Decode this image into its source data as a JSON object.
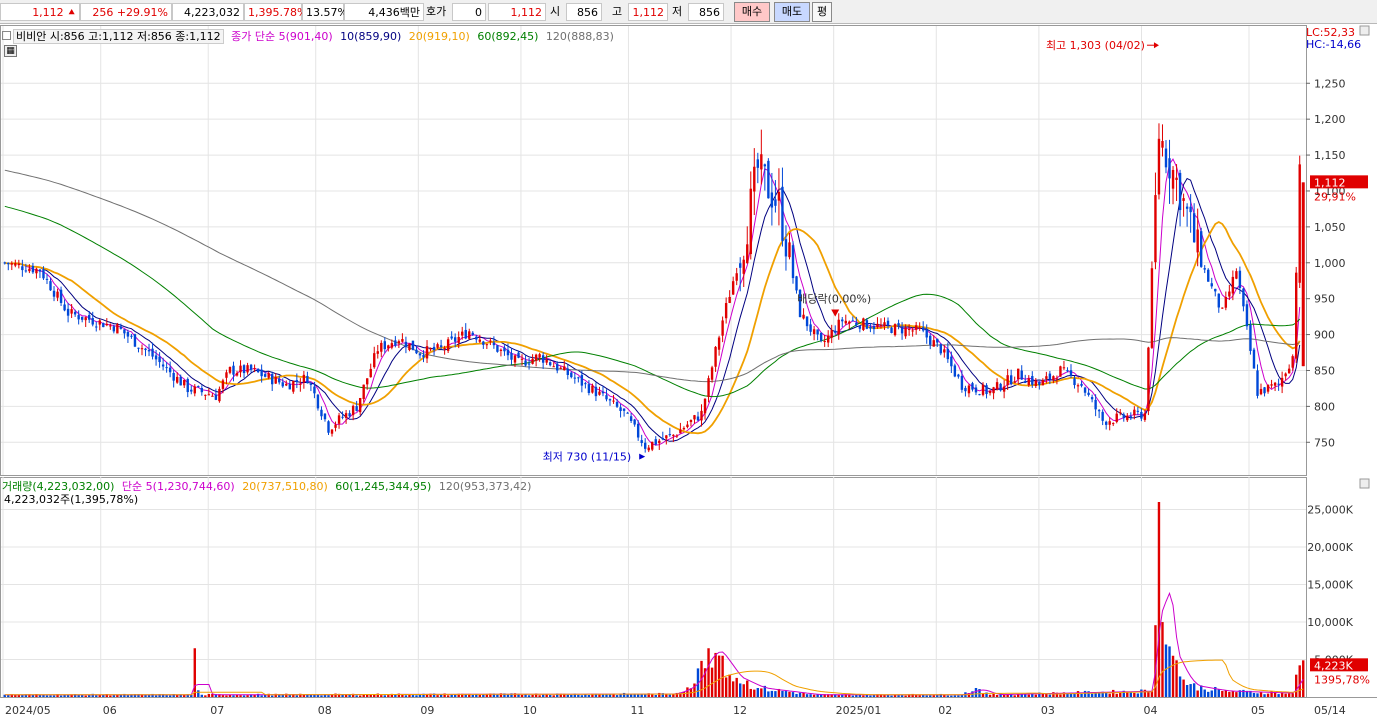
{
  "top_bar": {
    "price": "1,112",
    "change": "256",
    "change_pct": "+29.91%",
    "volume": "4,223,032",
    "volume_pct": "1,395.78%",
    "turnover": "13.57%",
    "amount": "4,436백만",
    "quote_label": "호가",
    "quote_value": "0",
    "quote_price": "1,112",
    "open_label": "시",
    "open_value": "856",
    "high_label": "고",
    "high_value": "1,112",
    "low_label": "저",
    "low_value": "856",
    "buy_label": "매수",
    "sell_label": "매도",
    "flat_label": "평",
    "colors": {
      "up": "#e00000",
      "down": "#0000cc"
    }
  },
  "price_panel": {
    "legend": {
      "stock": "비비안 시:856 고:1,112 저:856 종:1,112",
      "ma_label": "종가 단순 5(901,40)",
      "ma10": "10(859,90)",
      "ma20": "20(919,10)",
      "ma60": "60(892,45)",
      "ma120": "120(888,83)"
    },
    "right_info": {
      "lc": "LC:52,33",
      "hc": "HC:-14,66"
    },
    "current_price_tag": "1,112",
    "current_change_tag": "29,91%",
    "high_marker": "최고 1,303 (04/02)",
    "low_marker": "최저 730 (11/15)",
    "ex_dividend_marker": "배당락(0,00%)"
  },
  "volume_panel": {
    "legend": {
      "volume": "거래량(4,223,032,00)",
      "ma5": "단순 5(1,230,744,60)",
      "ma20": "20(737,510,80)",
      "ma60": "60(1,245,344,95)",
      "ma120": "120(953,373,42)"
    },
    "sub_label": "4,223,032주(1,395,78%)",
    "current_volume_tag": "4,223K",
    "current_volume_pct": "1395,78%"
  },
  "chart_data": {
    "type": "candlestick",
    "price_axis": {
      "ticks": [
        750,
        800,
        850,
        900,
        950,
        1000,
        1050,
        1100,
        1150,
        1200,
        1250
      ],
      "tick_labels": [
        "750",
        "800",
        "850",
        "900",
        "950",
        "1,000",
        "1,050",
        "1,100",
        "1,150",
        "1,200",
        "1,250"
      ],
      "range": [
        710,
        1320
      ]
    },
    "volume_axis": {
      "ticks": [
        5000,
        10000,
        15000,
        20000,
        25000
      ],
      "tick_labels": [
        "5,000K",
        "10,000K",
        "15,000K",
        "20,000K",
        "25,000K"
      ],
      "range": [
        0,
        28000
      ]
    },
    "x_axis": {
      "labels": [
        "2024/05",
        "06",
        "07",
        "08",
        "09",
        "10",
        "11",
        "12",
        "2025/01",
        "02",
        "03",
        "04",
        "05",
        "05/14"
      ]
    },
    "series": [
      {
        "name": "5",
        "color": "#cc00cc"
      },
      {
        "name": "10",
        "color": "#000080"
      },
      {
        "name": "20",
        "color": "#f0a000"
      },
      {
        "name": "60",
        "color": "#008000"
      },
      {
        "name": "120",
        "color": "#707070"
      }
    ],
    "anchors": [
      {
        "x": 0,
        "p": 1000
      },
      {
        "x": 10,
        "p": 990
      },
      {
        "x": 18,
        "p": 930
      },
      {
        "x": 32,
        "p": 910
      },
      {
        "x": 42,
        "p": 870
      },
      {
        "x": 52,
        "p": 825
      },
      {
        "x": 60,
        "p": 815
      },
      {
        "x": 64,
        "p": 850
      },
      {
        "x": 70,
        "p": 850
      },
      {
        "x": 80,
        "p": 830
      },
      {
        "x": 86,
        "p": 840
      },
      {
        "x": 92,
        "p": 770
      },
      {
        "x": 100,
        "p": 800
      },
      {
        "x": 106,
        "p": 880
      },
      {
        "x": 112,
        "p": 895
      },
      {
        "x": 118,
        "p": 875
      },
      {
        "x": 124,
        "p": 880
      },
      {
        "x": 132,
        "p": 905
      },
      {
        "x": 140,
        "p": 880
      },
      {
        "x": 146,
        "p": 860
      },
      {
        "x": 152,
        "p": 870
      },
      {
        "x": 160,
        "p": 845
      },
      {
        "x": 168,
        "p": 820
      },
      {
        "x": 176,
        "p": 790
      },
      {
        "x": 182,
        "p": 745
      },
      {
        "x": 190,
        "p": 760
      },
      {
        "x": 198,
        "p": 790
      },
      {
        "x": 204,
        "p": 920
      },
      {
        "x": 210,
        "p": 1030
      },
      {
        "x": 214,
        "p": 1130
      },
      {
        "x": 220,
        "p": 1080
      },
      {
        "x": 226,
        "p": 930
      },
      {
        "x": 232,
        "p": 885
      },
      {
        "x": 238,
        "p": 920
      },
      {
        "x": 250,
        "p": 910
      },
      {
        "x": 260,
        "p": 905
      },
      {
        "x": 266,
        "p": 880
      },
      {
        "x": 272,
        "p": 830
      },
      {
        "x": 280,
        "p": 820
      },
      {
        "x": 288,
        "p": 845
      },
      {
        "x": 294,
        "p": 830
      },
      {
        "x": 300,
        "p": 850
      },
      {
        "x": 306,
        "p": 830
      },
      {
        "x": 312,
        "p": 780
      },
      {
        "x": 318,
        "p": 785
      },
      {
        "x": 324,
        "p": 790
      },
      {
        "x": 328,
        "p": 1180
      },
      {
        "x": 334,
        "p": 1100
      },
      {
        "x": 340,
        "p": 1000
      },
      {
        "x": 346,
        "p": 930
      },
      {
        "x": 350,
        "p": 990
      },
      {
        "x": 356,
        "p": 820
      },
      {
        "x": 362,
        "p": 830
      },
      {
        "x": 366,
        "p": 870
      },
      {
        "x": 368,
        "p": 1112
      }
    ],
    "volume_anchors": [
      {
        "x": 0,
        "v": 300
      },
      {
        "x": 53,
        "v": 300
      },
      {
        "x": 54,
        "v": 6500
      },
      {
        "x": 55,
        "v": 900
      },
      {
        "x": 56,
        "v": 300
      },
      {
        "x": 190,
        "v": 400
      },
      {
        "x": 196,
        "v": 1800
      },
      {
        "x": 200,
        "v": 6500
      },
      {
        "x": 204,
        "v": 5500
      },
      {
        "x": 206,
        "v": 3000
      },
      {
        "x": 214,
        "v": 1200
      },
      {
        "x": 230,
        "v": 300
      },
      {
        "x": 272,
        "v": 300
      },
      {
        "x": 276,
        "v": 1200
      },
      {
        "x": 280,
        "v": 300
      },
      {
        "x": 326,
        "v": 800
      },
      {
        "x": 328,
        "v": 26000
      },
      {
        "x": 330,
        "v": 7000
      },
      {
        "x": 332,
        "v": 5500
      },
      {
        "x": 336,
        "v": 1600
      },
      {
        "x": 346,
        "v": 800
      },
      {
        "x": 366,
        "v": 500
      },
      {
        "x": 368,
        "v": 4223
      }
    ]
  }
}
